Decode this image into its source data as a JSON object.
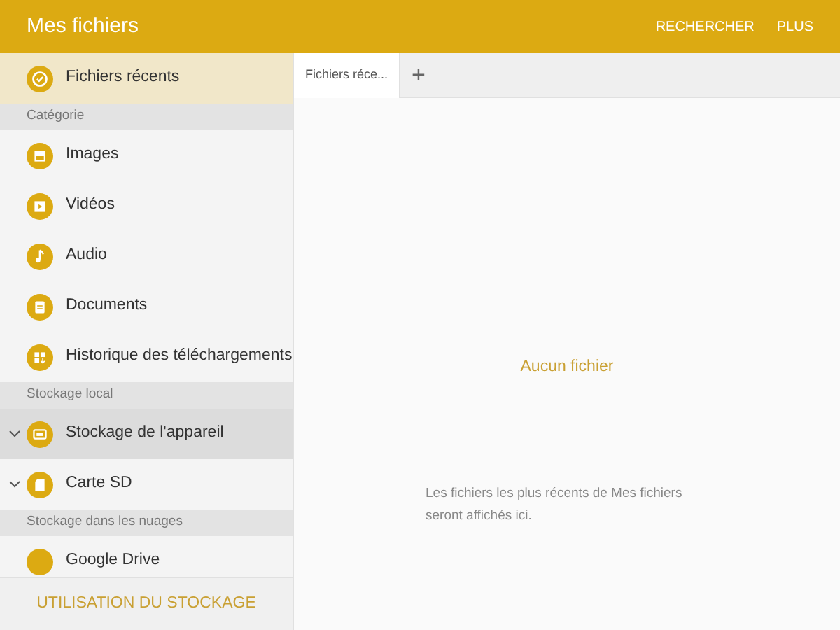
{
  "app_bar": {
    "title": "Mes fichiers",
    "actions": [
      "RECHERCHER",
      "PLUS"
    ]
  },
  "sidebar": {
    "items": [
      {
        "kind": "item",
        "label": "Fichiers récents",
        "selected": true,
        "highlighted": false,
        "chevron": false
      },
      {
        "kind": "header",
        "label": "Catégorie"
      },
      {
        "kind": "item",
        "label": "Images",
        "selected": false,
        "highlighted": false,
        "chevron": false
      },
      {
        "kind": "item",
        "label": "Vidéos",
        "selected": false,
        "highlighted": false,
        "chevron": false
      },
      {
        "kind": "item",
        "label": "Audio",
        "selected": false,
        "highlighted": false,
        "chevron": false
      },
      {
        "kind": "item",
        "label": "Documents",
        "selected": false,
        "highlighted": false,
        "chevron": false
      },
      {
        "kind": "item",
        "label": "Historique des téléchargements",
        "selected": false,
        "highlighted": false,
        "chevron": false
      },
      {
        "kind": "header",
        "label": "Stockage local"
      },
      {
        "kind": "item",
        "label": "Stockage de l'appareil",
        "selected": false,
        "highlighted": true,
        "chevron": true
      },
      {
        "kind": "item",
        "label": "Carte SD",
        "selected": false,
        "highlighted": false,
        "chevron": true
      },
      {
        "kind": "header",
        "label": "Stockage dans les nuages"
      },
      {
        "kind": "item",
        "label": "Google Drive",
        "selected": false,
        "highlighted": false,
        "chevron": false
      }
    ],
    "footer_button": "UTILISATION DU STOCKAGE"
  },
  "tabs": [
    {
      "label": "Fichiers réce...",
      "selected": true
    }
  ],
  "add_tab": "+",
  "empty_state": {
    "title": "Aucun fichier",
    "message": "Les fichiers les plus récents de Mes fichiers seront affichés ici."
  }
}
